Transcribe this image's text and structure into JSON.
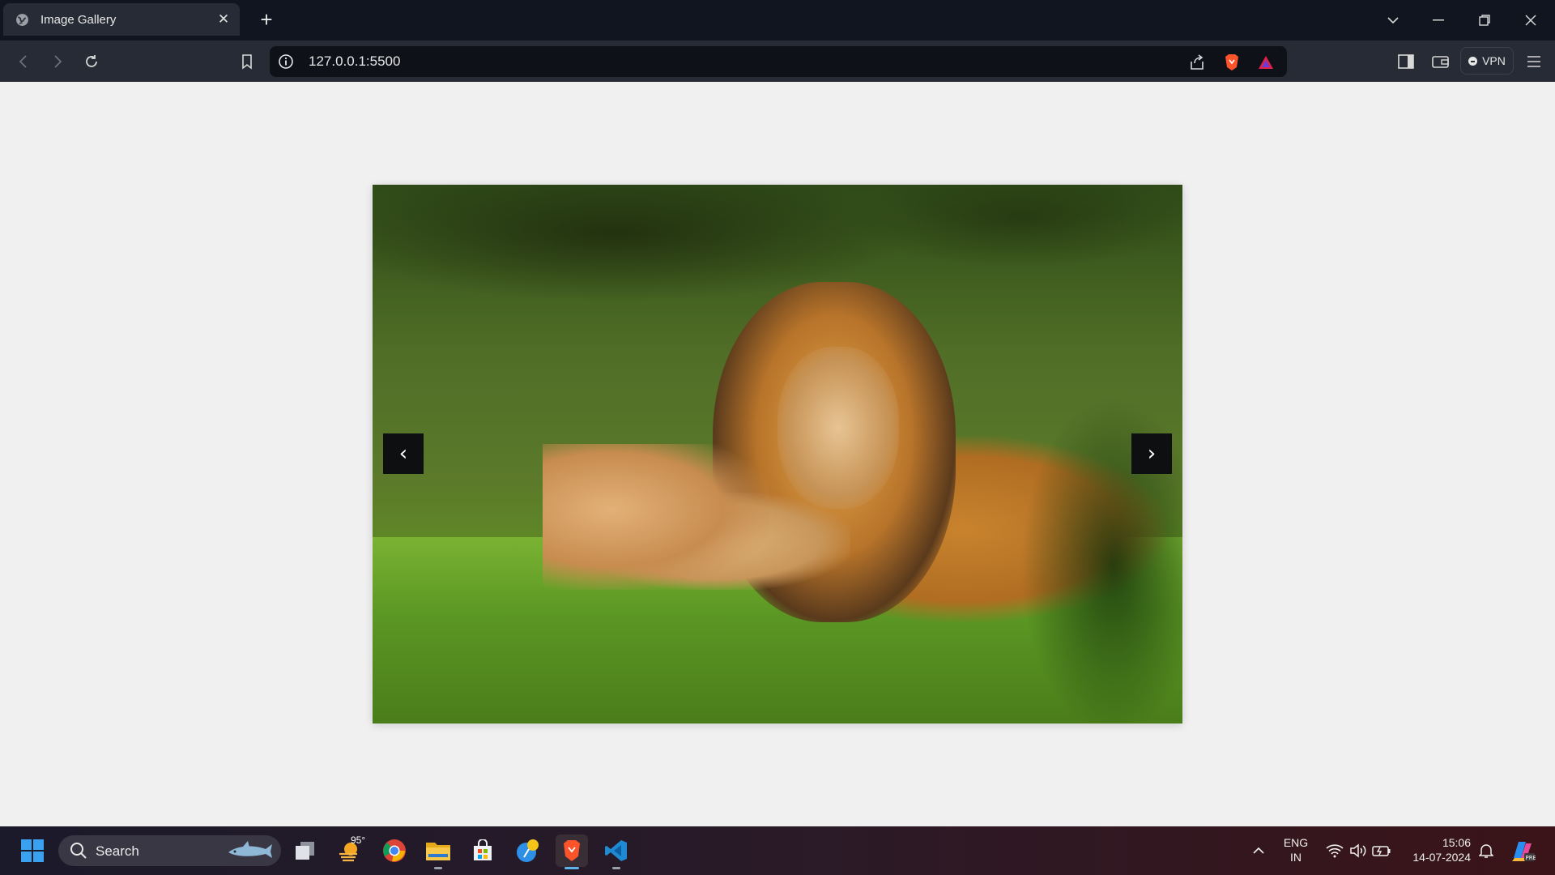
{
  "browser": {
    "tab_title": "Image Gallery",
    "url": "127.0.0.1:5500",
    "vpn_label": "VPN"
  },
  "gallery": {
    "image_alt": "Lion and cub resting on grass",
    "prev_label": "‹",
    "next_label": "›"
  },
  "taskbar": {
    "search_label": "Search",
    "weather_temp": "95°",
    "language": "ENG",
    "region": "IN",
    "time": "15:06",
    "date": "14-07-2024"
  }
}
